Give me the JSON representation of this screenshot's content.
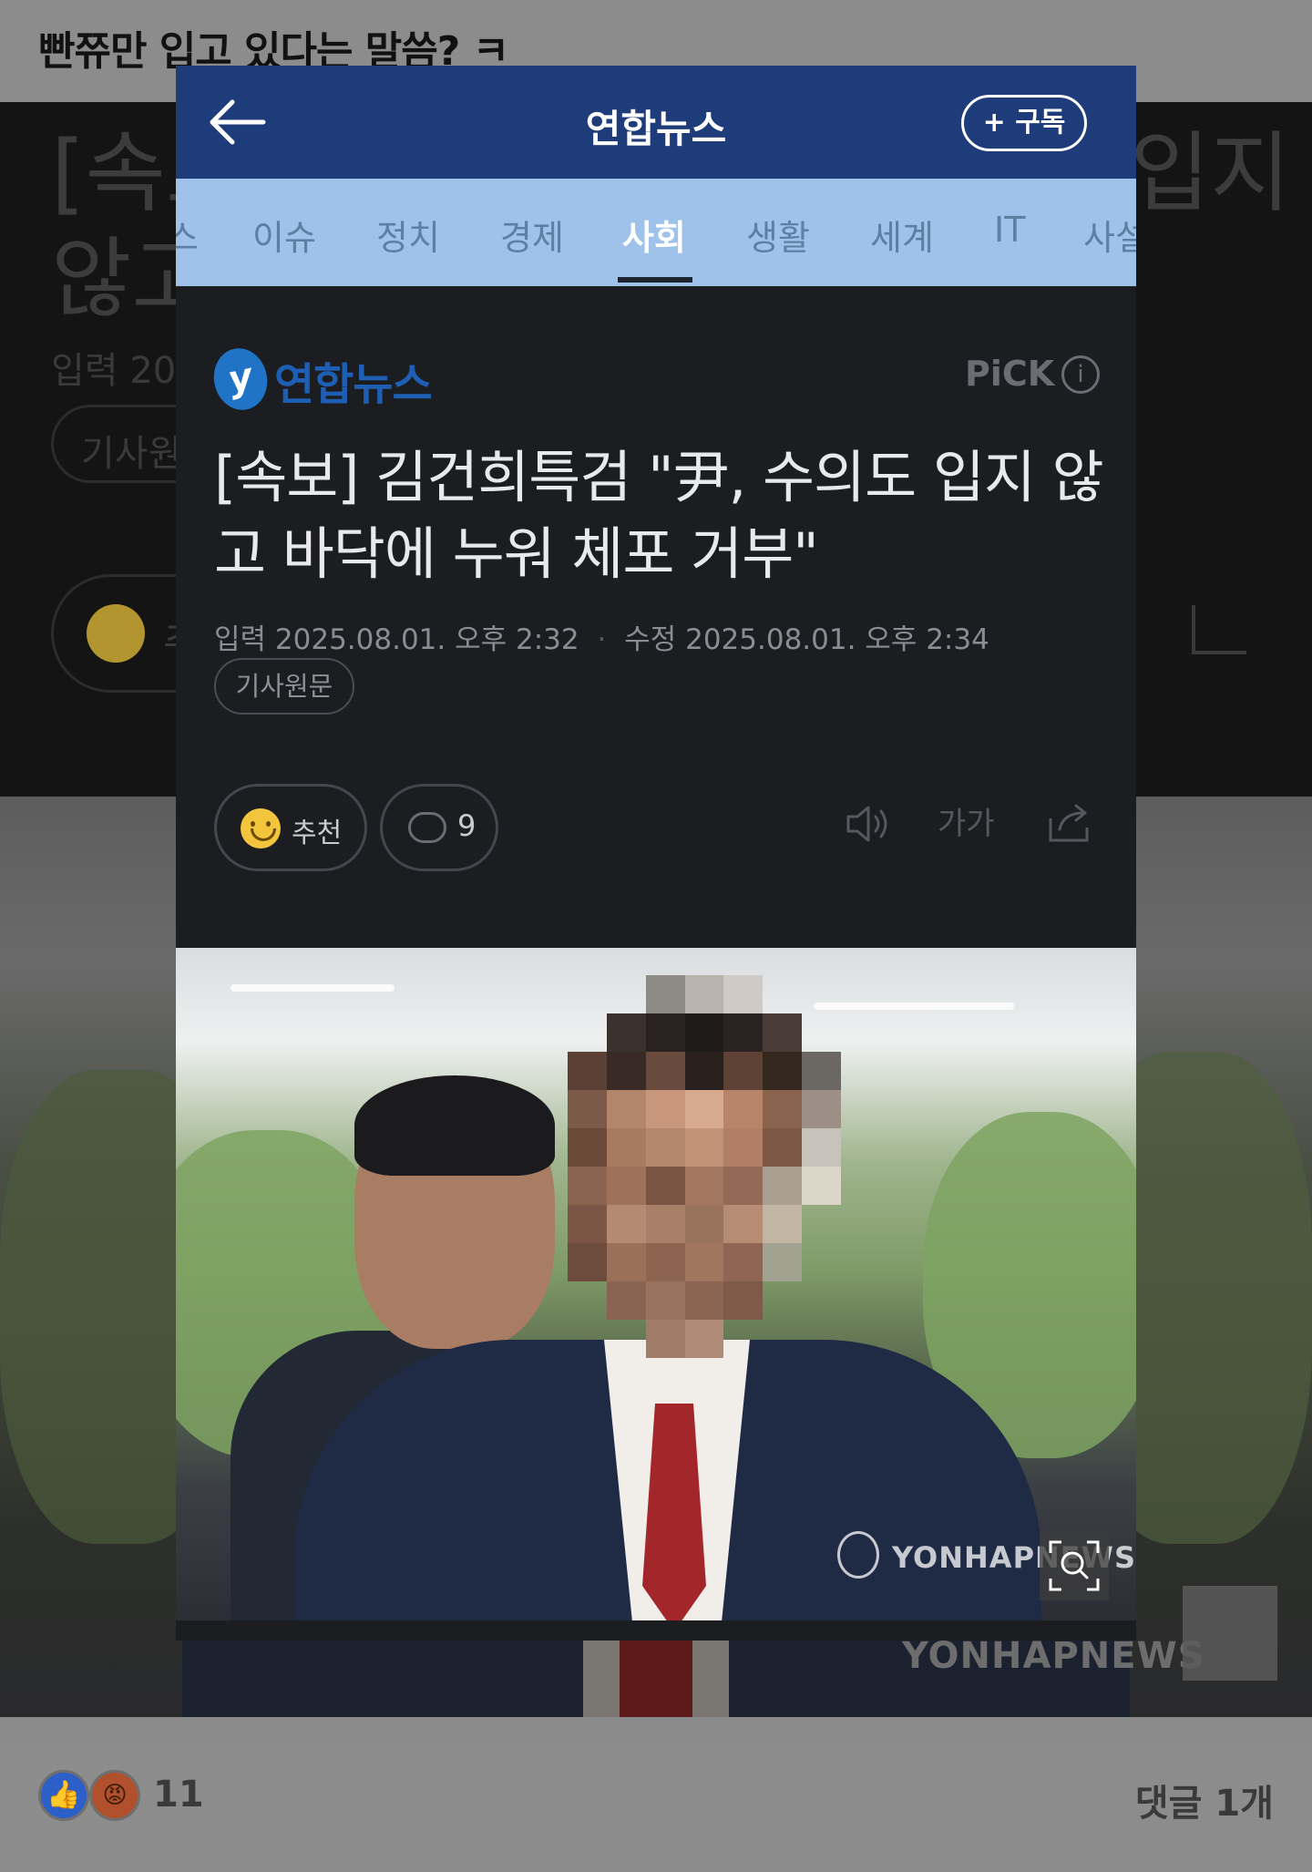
{
  "post": {
    "caption": "빤쮸만 입고 있다는 말씀? ㅋ",
    "reaction_count": "11",
    "comment_count": "댓글 1개"
  },
  "background": {
    "headline_fragment": "[속보",
    "headline_line2": "않고",
    "headline_tail": "입지",
    "meta_fragment": "입력 20",
    "pill_fragment": "기사원",
    "reaction_fragment": "추"
  },
  "app": {
    "title": "연합뉴스",
    "subscribe_label": "+ 구독",
    "categories": [
      "스",
      "이슈",
      "정치",
      "경제",
      "사회",
      "생활",
      "세계",
      "IT",
      "사설"
    ],
    "active_category": "사회"
  },
  "article": {
    "publisher": "연합뉴스",
    "pick_label": "PiCK",
    "headline": "[속보] 김건희특검 \"尹, 수의도 입지 않고 바닥에 누워 체포 거부\"",
    "input_label": "입력",
    "input_time": "2025.08.01. 오후 2:32",
    "modified_label": "수정",
    "modified_time": "2025.08.01. 오후 2:34",
    "source_button": "기사원문",
    "recommend_label": "추천",
    "comment_count": "9",
    "font_size_icon": "가가",
    "photo_watermark": "YONHAPNEWS"
  },
  "colors": {
    "header_bg": "#1f3c7a",
    "category_bg": "#9ec2ea",
    "article_bg": "#1c1d21",
    "tie": "#a3262a"
  }
}
